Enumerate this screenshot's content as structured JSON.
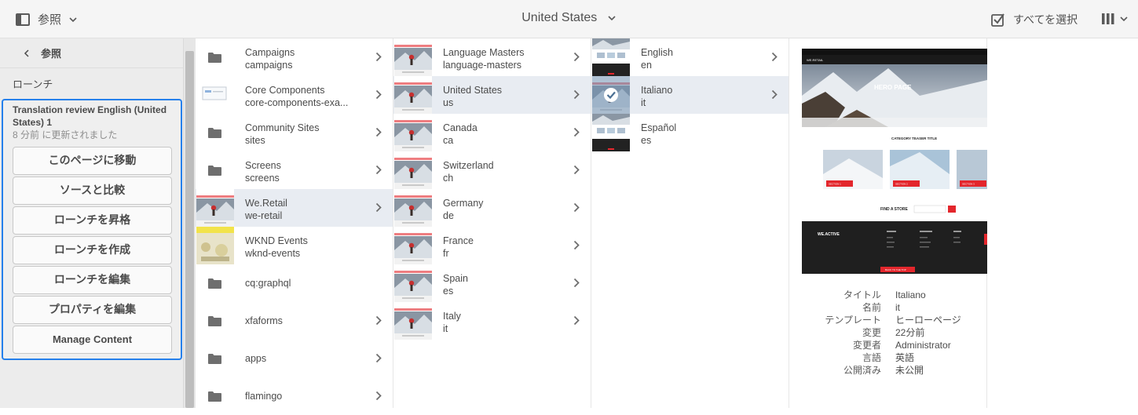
{
  "header": {
    "rail_label": "参照",
    "location_title": "United States",
    "select_all_label": "すべてを選択"
  },
  "rail": {
    "back_label": "参照",
    "section_title": "ローンチ",
    "launch": {
      "title": "Translation review English (United States) 1",
      "updated": "8 分前 に更新されました",
      "buttons": [
        "このページに移動",
        "ソースと比較",
        "ローンチを昇格",
        "ローンチを作成",
        "ローンチを編集",
        "プロパティを編集",
        "Manage Content"
      ]
    }
  },
  "columns": {
    "col1": [
      {
        "title": "Campaigns",
        "name": "campaigns",
        "thumb": "folder"
      },
      {
        "title": "Core Components",
        "name": "core-components-exa...",
        "thumb": "component"
      },
      {
        "title": "Community Sites",
        "name": "sites",
        "thumb": "folder"
      },
      {
        "title": "Screens",
        "name": "screens",
        "thumb": "folder"
      },
      {
        "title": "We.Retail",
        "name": "we-retail",
        "thumb": "page"
      },
      {
        "title": "WKND Events",
        "name": "wknd-events",
        "thumb": "wknd"
      },
      {
        "title": "cq:graphql",
        "name": "",
        "thumb": "folder"
      },
      {
        "title": "xfaforms",
        "name": "",
        "thumb": "folder"
      },
      {
        "title": "apps",
        "name": "",
        "thumb": "folder"
      },
      {
        "title": "flamingo",
        "name": "",
        "thumb": "folder"
      }
    ],
    "col2": [
      {
        "title": "Language Masters",
        "name": "language-masters"
      },
      {
        "title": "United States",
        "name": "us"
      },
      {
        "title": "Canada",
        "name": "ca"
      },
      {
        "title": "Switzerland",
        "name": "ch"
      },
      {
        "title": "Germany",
        "name": "de"
      },
      {
        "title": "France",
        "name": "fr"
      },
      {
        "title": "Spain",
        "name": "es"
      },
      {
        "title": "Italy",
        "name": "it"
      }
    ],
    "col3": [
      {
        "title": "English",
        "name": "en"
      },
      {
        "title": "Italiano",
        "name": "it"
      },
      {
        "title": "Español",
        "name": "es"
      }
    ]
  },
  "preview": {
    "brand": "WE.RETAIL",
    "hero_text": "HERO PAGE",
    "teaser_title": "CATEGORY TEASER TITLE",
    "find_store": "FIND A STORE",
    "footer_brand": "WE.ACTIVE",
    "back_to_top": "BACK TO THE TOP",
    "section_labels": [
      "SECTION 1",
      "SECTION 2",
      "SECTION 3"
    ]
  },
  "metadata": [
    {
      "key": "タイトル",
      "value": "Italiano"
    },
    {
      "key": "名前",
      "value": "it"
    },
    {
      "key": "テンプレート",
      "value": "ヒーローページ"
    },
    {
      "key": "変更",
      "value": "22分前"
    },
    {
      "key": "変更者",
      "value": "Administrator"
    },
    {
      "key": "言語",
      "value": "英語"
    },
    {
      "key": "公開済み",
      "value": "未公開"
    }
  ],
  "colors": {
    "accent": "#2680eb",
    "selected_row": "#e8ecf2",
    "brand_red": "#e3262c"
  }
}
